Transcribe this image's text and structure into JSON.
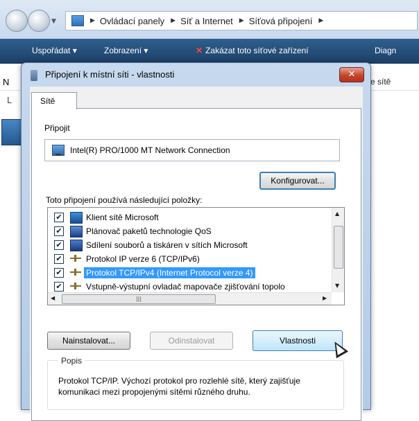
{
  "explorer": {
    "breadcrumb": [
      "Ovládací panely",
      "Síť a Internet",
      "Síťová připojení"
    ],
    "toolbar": {
      "organize": "Uspořádat ▾",
      "views": "Zobrazení ▾",
      "disable": "Zakázat toto síťové zařízení",
      "diagnose": "Diagn"
    },
    "list": {
      "left_header": "N",
      "right_header": "e sítě",
      "left_letter": "L"
    }
  },
  "dialog": {
    "title": "Připojení k místní síti - vlastnosti",
    "close_glyph": "✕",
    "tab": "Sítě",
    "connect_label": "Připojit",
    "adapter": "Intel(R) PRO/1000 MT Network Connection",
    "configure_button": "Konfigurovat...",
    "items_label": "Toto připojení používá následující položky:",
    "items": [
      {
        "label": "Klient sítě Microsoft",
        "checked": true,
        "icon": "network-client-icon"
      },
      {
        "label": "Plánovač paketů technologie QoS",
        "checked": true,
        "icon": "qos-scheduler-icon"
      },
      {
        "label": "Sdílení souborů a tiskáren v sítích Microsoft",
        "checked": true,
        "icon": "file-sharing-icon"
      },
      {
        "label": "Protokol IP verze 6 (TCP/IPv6)",
        "checked": true,
        "icon": "protocol-icon"
      },
      {
        "label": "Protokol TCP/IPv4 (Internet Protocol verze 4)",
        "checked": true,
        "icon": "protocol-icon",
        "selected": true
      },
      {
        "label": "Vstupně-výstupní ovladač mapovače zjišťování topolo",
        "checked": true,
        "icon": "protocol-icon"
      }
    ],
    "install_button": "Nainstalovat...",
    "uninstall_button": "Odinstalovat",
    "properties_button": "Vlastnosti",
    "description_title": "Popis",
    "description_text": "Protokol TCP/IP. Výchozí protokol pro rozlehlé sítě, který zajišťuje komunikaci mezi propojenými sítěmi různého druhu."
  }
}
